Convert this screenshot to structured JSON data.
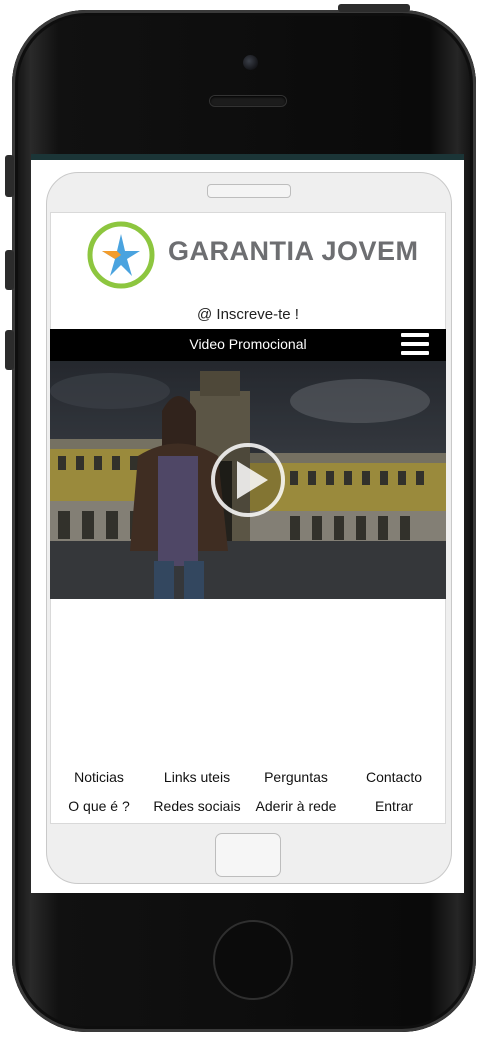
{
  "brand": {
    "name": "GARANTIA JOVEM"
  },
  "subtitle": "@ Inscreve-te !",
  "video": {
    "bar_title": "Video Promocional"
  },
  "nav": {
    "row1": [
      "Noticias",
      "Links uteis",
      "Perguntas",
      "Contacto"
    ],
    "row2": [
      "O que é ?",
      "Redes sociais",
      "Aderir à rede",
      "Entrar"
    ]
  },
  "colors": {
    "logo_ring": "#8dc63f",
    "star_blue": "#4aa3df",
    "star_orange": "#f39c2b",
    "logo_text": "#6d6e71",
    "bar": "#000000"
  }
}
